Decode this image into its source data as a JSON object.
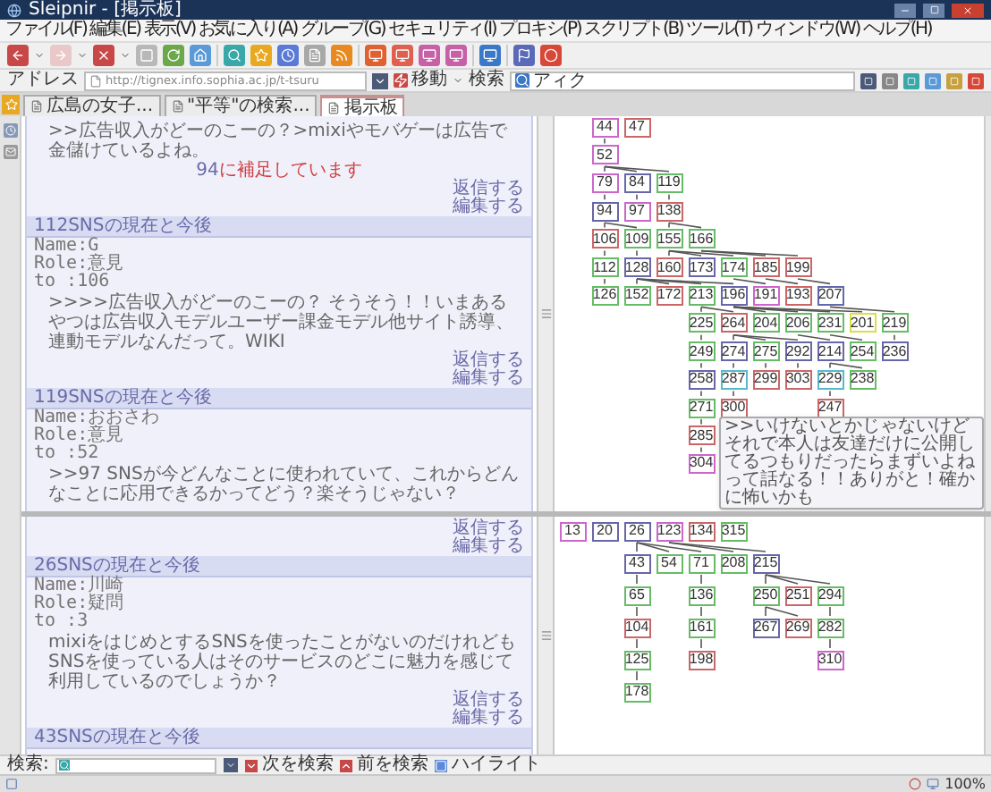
{
  "window": {
    "title": "Sleipnir - [掲示板]"
  },
  "menu": [
    "ファイル(F)",
    "編集(E)",
    "表示(V)",
    "お気に入り(A)",
    "グループ(G)",
    "セキュリティ(I)",
    "プロキシ(P)",
    "スクリプト(B)",
    "ツール(T)",
    "ウィンドウ(W)",
    "ヘルプ(H)"
  ],
  "address_bar": {
    "label": "アドレス",
    "url": "http://tignex.info.sophia.ac.jp/t-tsuru",
    "go": "移動",
    "search_label": "検索",
    "search_value": "アィク"
  },
  "tabs": [
    {
      "label": "広島の女子...",
      "selected": false
    },
    {
      "label": "\"平等\"の検索...",
      "selected": false
    },
    {
      "label": "掲示板",
      "selected": true
    }
  ],
  "posts_upper": [
    {
      "body": ">>広告収入がどーのこーの？>mixiやモバゲーは広告で金儲けているよね。",
      "note": {
        "ref": "94",
        "text": "に補足しています"
      },
      "links": [
        "返信する",
        "編集する"
      ]
    },
    {
      "title": "112SNSの現在と今後",
      "meta": [
        "Name:G",
        "Role:意見",
        "to :106"
      ],
      "body": ">>>>広告収入がどーのこーの？ そうそう！！いまあるやつは広告収入モデルユーザー課金モデル他サイト誘導、連動モデルなんだって。WIKI",
      "links": [
        "返信する",
        "編集する"
      ]
    },
    {
      "title": "119SNSの現在と今後",
      "meta": [
        "Name:おおさわ",
        "Role:意見",
        "to :52"
      ],
      "body": ">>97 SNSが今どんなことに使われていて、これからどんなことに応用できるかってどう？楽そうじゃない？"
    }
  ],
  "posts_lower": [
    {
      "links": [
        "返信する",
        "編集する"
      ]
    },
    {
      "title": "26SNSの現在と今後",
      "meta": [
        "Name:川崎",
        "Role:疑問",
        "to :3"
      ],
      "body": "mixiをはじめとするSNSを使ったことがないのだけれども SNSを使っている人はそのサービスのどこに魅力を感じて利用しているのでしょうか？",
      "links": [
        "返信する",
        "編集する"
      ]
    },
    {
      "title": "43SNSの現在と今後"
    }
  ],
  "tree_upper": {
    "roots": [
      {
        "label": "44",
        "color": "#cc66cc",
        "children": [
          {
            "label": "52",
            "color": "#cc66cc",
            "children": [
              {
                "label": "79",
                "color": "#cc66cc",
                "children": [
                  {
                    "label": "94",
                    "color": "#6666aa",
                    "children": [
                      {
                        "label": "106",
                        "color": "#cc6666",
                        "children": [
                          {
                            "label": "112",
                            "color": "#66bb66",
                            "children": [
                              {
                                "label": "126",
                                "color": "#66bb66"
                              }
                            ]
                          }
                        ]
                      },
                      {
                        "label": "109",
                        "color": "#66bb66",
                        "children": [
                          {
                            "label": "128",
                            "color": "#6666aa",
                            "children": [
                              {
                                "label": "152",
                                "color": "#66bb66"
                              },
                              {
                                "label": "172",
                                "color": "#cc6666"
                              },
                              {
                                "label": "213",
                                "color": "#66bb66",
                                "children": [
                                  {
                                    "label": "225",
                                    "color": "#66bb66",
                                    "children": [
                                      {
                                        "label": "249",
                                        "color": "#66bb66",
                                        "children": [
                                          {
                                            "label": "258",
                                            "color": "#6666aa",
                                            "children": [
                                              {
                                                "label": "271",
                                                "color": "#66bb66",
                                                "children": [
                                                  {
                                                    "label": "285",
                                                    "color": "#cc6666",
                                                    "children": [
                                                      {
                                                        "label": "304",
                                                        "color": "#cc66cc"
                                                      }
                                                    ]
                                                  }
                                                ]
                                              }
                                            ]
                                          }
                                        ]
                                      }
                                    ]
                                  },
                                  {
                                    "label": "264",
                                    "color": "#cc6666",
                                    "children": [
                                      {
                                        "label": "274",
                                        "color": "#6666aa",
                                        "children": [
                                          {
                                            "label": "287",
                                            "color": "#55bbcc",
                                            "children": [
                                              {
                                                "label": "300",
                                                "color": "#cc6666"
                                              }
                                            ]
                                          }
                                        ]
                                      },
                                      {
                                        "label": "275",
                                        "color": "#66bb66",
                                        "children": [
                                          {
                                            "label": "299",
                                            "color": "#cc6666"
                                          }
                                        ]
                                      },
                                      {
                                        "label": "292",
                                        "color": "#6666aa",
                                        "children": [
                                          {
                                            "label": "303",
                                            "color": "#cc6666"
                                          }
                                        ]
                                      }
                                    ]
                                  }
                                ]
                              },
                              {
                                "label": "196",
                                "color": "#6666aa",
                                "children": [
                                  {
                                    "label": "204",
                                    "color": "#66bb66"
                                  },
                                  {
                                    "label": "206",
                                    "color": "#66bb66",
                                    "children": [
                                      {
                                        "label": "214",
                                        "color": "#6666aa",
                                        "children": [
                                          {
                                            "label": "229",
                                            "color": "#55bbcc",
                                            "children": [
                                              {
                                                "label": "247",
                                                "color": "#cc6666"
                                              }
                                            ]
                                          },
                                          {
                                            "label": "238",
                                            "color": "#66bb66"
                                          }
                                        ]
                                      }
                                    ]
                                  },
                                  {
                                    "label": "231",
                                    "color": "#66bb66",
                                    "children": [
                                      {
                                        "label": "254",
                                        "color": "#66bb66"
                                      }
                                    ]
                                  },
                                  {
                                    "label": "201",
                                    "color": "#dddd44"
                                  }
                                ]
                              }
                            ]
                          }
                        ]
                      }
                    ]
                  }
                ]
              },
              {
                "label": "84",
                "color": "#6666aa",
                "children": [
                  {
                    "label": "97",
                    "color": "#cc66cc"
                  }
                ]
              },
              {
                "label": "119",
                "color": "#66bb66",
                "children": [
                  {
                    "label": "138",
                    "color": "#cc6666",
                    "children": [
                      {
                        "label": "155",
                        "color": "#66bb66",
                        "children": [
                          {
                            "label": "160",
                            "color": "#cc6666"
                          },
                          {
                            "label": "173",
                            "color": "#6666aa"
                          },
                          {
                            "label": "174",
                            "color": "#66bb66",
                            "children": [
                              {
                                "label": "191",
                                "color": "#cc66cc"
                              }
                            ]
                          }
                        ]
                      },
                      {
                        "label": "166",
                        "color": "#66bb66",
                        "children": [
                          {
                            "label": "185",
                            "color": "#cc6666",
                            "children": [
                              {
                                "label": "193",
                                "color": "#cc6666"
                              }
                            ]
                          },
                          {
                            "label": "199",
                            "color": "#cc6666",
                            "children": [
                              {
                                "label": "207",
                                "color": "#6666aa",
                                "children": [
                                  {
                                    "label": "219",
                                    "color": "#66bb66",
                                    "children": [
                                      {
                                        "label": "236",
                                        "color": "#6666aa"
                                      }
                                    ]
                                  }
                                ]
                              }
                            ]
                          }
                        ]
                      }
                    ]
                  }
                ]
              }
            ]
          }
        ]
      },
      {
        "label": "47",
        "color": "#cc6666"
      }
    ]
  },
  "tooltip": {
    "text": ">>いけないとかじゃないけどそれで本人は友達だけに公開してるつもりだったらまずいよねって話なる！！ありがと！確かに怖いかも"
  },
  "tree_lower": {
    "roots": [
      {
        "label": "13",
        "color": "#cc66cc"
      },
      {
        "label": "20",
        "color": "#6666aa"
      },
      {
        "label": "26",
        "color": "#6666aa",
        "children": [
          {
            "label": "43",
            "color": "#6666aa",
            "children": [
              {
                "label": "65",
                "color": "#66bb66",
                "children": [
                  {
                    "label": "104",
                    "color": "#cc6666",
                    "children": [
                      {
                        "label": "125",
                        "color": "#66bb66",
                        "children": [
                          {
                            "label": "178",
                            "color": "#66bb66"
                          }
                        ]
                      }
                    ]
                  }
                ]
              }
            ]
          },
          {
            "label": "54",
            "color": "#66bb66"
          },
          {
            "label": "71",
            "color": "#66bb66",
            "children": [
              {
                "label": "136",
                "color": "#66bb66",
                "children": [
                  {
                    "label": "161",
                    "color": "#66bb66",
                    "children": [
                      {
                        "label": "198",
                        "color": "#cc6666"
                      }
                    ]
                  }
                ]
              }
            ]
          }
        ]
      },
      {
        "label": "123",
        "color": "#cc66cc",
        "children": [
          {
            "label": "208",
            "color": "#66bb66"
          },
          {
            "label": "215",
            "color": "#6666aa",
            "children": [
              {
                "label": "250",
                "color": "#66bb66",
                "children": [
                  {
                    "label": "267",
                    "color": "#6666aa"
                  },
                  {
                    "label": "269",
                    "color": "#cc6666"
                  }
                ]
              },
              {
                "label": "251",
                "color": "#cc6666"
              },
              {
                "label": "294",
                "color": "#66bb66",
                "children": [
                  {
                    "label": "282",
                    "color": "#66bb66",
                    "children": [
                      {
                        "label": "310",
                        "color": "#cc66cc"
                      }
                    ]
                  }
                ]
              }
            ]
          }
        ]
      },
      {
        "label": "134",
        "color": "#cc6666"
      },
      {
        "label": "315",
        "color": "#66bb66"
      }
    ]
  },
  "find_bar": {
    "label": "検索:",
    "buttons": [
      "次を検索",
      "前を検索",
      "ハイライト"
    ]
  },
  "status_bar": {
    "zoom": "100%"
  }
}
